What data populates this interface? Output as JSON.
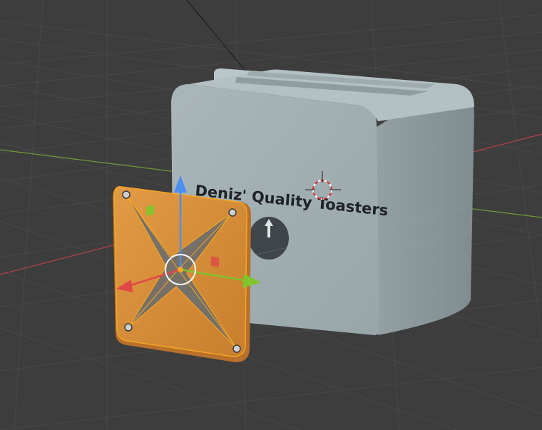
{
  "viewport": {
    "name": "3D Viewport",
    "background_color": "#3d3d3d",
    "grid_line_color": "#4a4a4a",
    "x_axis_color": "#c0404a",
    "y_axis_color": "#7aa33a"
  },
  "toaster": {
    "body_color": "#a3b0b4",
    "brand_text": "Deniz' Quality Toasters",
    "knob_color": "#3f4549",
    "knob_arrow": "up-arrow"
  },
  "selected_object": {
    "plate_color": "#d8913a",
    "star_color": "#6a6a6a",
    "selection_outline_color": "#f5a623"
  },
  "gizmo": {
    "x_arrow_color": "#e04848",
    "y_arrow_color": "#7fc42a",
    "z_arrow_color": "#4a8ef0"
  },
  "cursor": {
    "name": "3d-cursor"
  }
}
